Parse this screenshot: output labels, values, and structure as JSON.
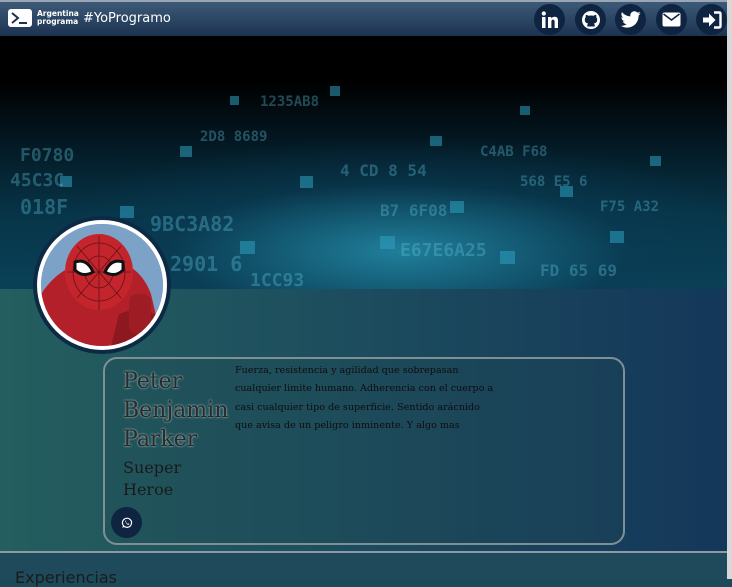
{
  "header": {
    "logo_line1": "Argentina",
    "logo_line2": "programa",
    "hashtag": "#YoProgramo",
    "icons": [
      "linkedin-icon",
      "github-icon",
      "twitter-icon",
      "envelope-icon",
      "sign-in-icon"
    ]
  },
  "profile": {
    "name_first": "Peter",
    "name_middle": "Benjamin",
    "name_last": "Parker",
    "role_line1": "Sueper",
    "role_line2": "Heroe",
    "description": "Fuerza, resistencia y agilidad que sobrepasan cualquier limite humano. Adherencia con el cuerpo a casi cualquier tipo de superficie. Sentido arácnido que avisa de un peligro inminente. Y algo mas"
  },
  "section": {
    "title": "Experiencias"
  },
  "colors": {
    "nav_button": "#0e2441",
    "nav_bar_top": "#3c5a78",
    "nav_bar_bottom": "#1c3350"
  }
}
